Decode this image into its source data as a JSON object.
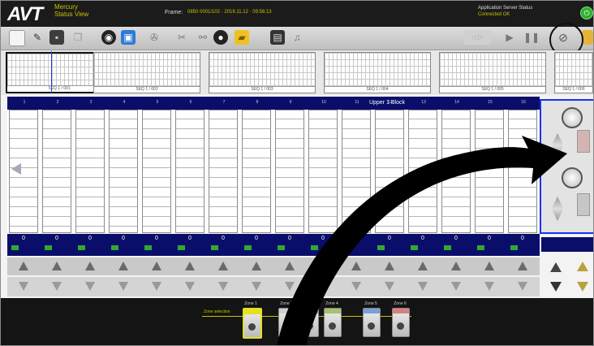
{
  "header": {
    "logo": "AVT",
    "logo_sub": "Mercury\nStatus View",
    "frame_label": "Frame:",
    "frame_value": "0850 0001/102 · 2019.11.12 · 09:56:13",
    "status_title": "Application Server Status",
    "status_value": "Connected OK",
    "power_icon": "power-icon"
  },
  "toolbar": {
    "icons": [
      "new-document-icon",
      "edit-icon",
      "save-icon",
      "copy-icon",
      "disc-icon",
      "camera-icon",
      "settings-icon",
      "scissors-icon",
      "link-icon",
      "record-icon",
      "folder-icon",
      "chart-icon",
      "music-icon",
      "sound-icon",
      "play-icon",
      "pause-icon",
      "zoom-icon"
    ],
    "colors": {
      "highlight": "#111111"
    }
  },
  "frames": [
    "SEQ 1 / 001",
    "SEQ 1 / 002",
    "SEQ 1 / 003",
    "SEQ 1 / 004",
    "SEQ 1 / 005",
    "SEQ 1 / 006"
  ],
  "grid": {
    "title": "Upper 1    Block",
    "columns": [
      "1",
      "2",
      "3",
      "4",
      "5",
      "6",
      "7",
      "8",
      "9",
      "10",
      "11",
      "12",
      "13",
      "14",
      "15",
      "16"
    ],
    "values": [
      "0",
      "0",
      "0",
      "0",
      "0",
      "0",
      "0",
      "0",
      "0",
      "0",
      "0",
      "0",
      "0",
      "0",
      "0",
      "0"
    ]
  },
  "dock": {
    "label": "Zone selection",
    "cards": [
      {
        "label": "Zone 1",
        "top_color": "#e6df22"
      },
      {
        "label": "Zone 2",
        "top_color": "#cfcfcf"
      },
      {
        "label": "Zone 3",
        "top_color": "#d28fd2"
      },
      {
        "label": "Zone 4",
        "top_color": "#a8c070"
      },
      {
        "label": "Zone 5",
        "top_color": "#7aa0d8"
      },
      {
        "label": "Zone 6",
        "top_color": "#d88080"
      }
    ]
  }
}
